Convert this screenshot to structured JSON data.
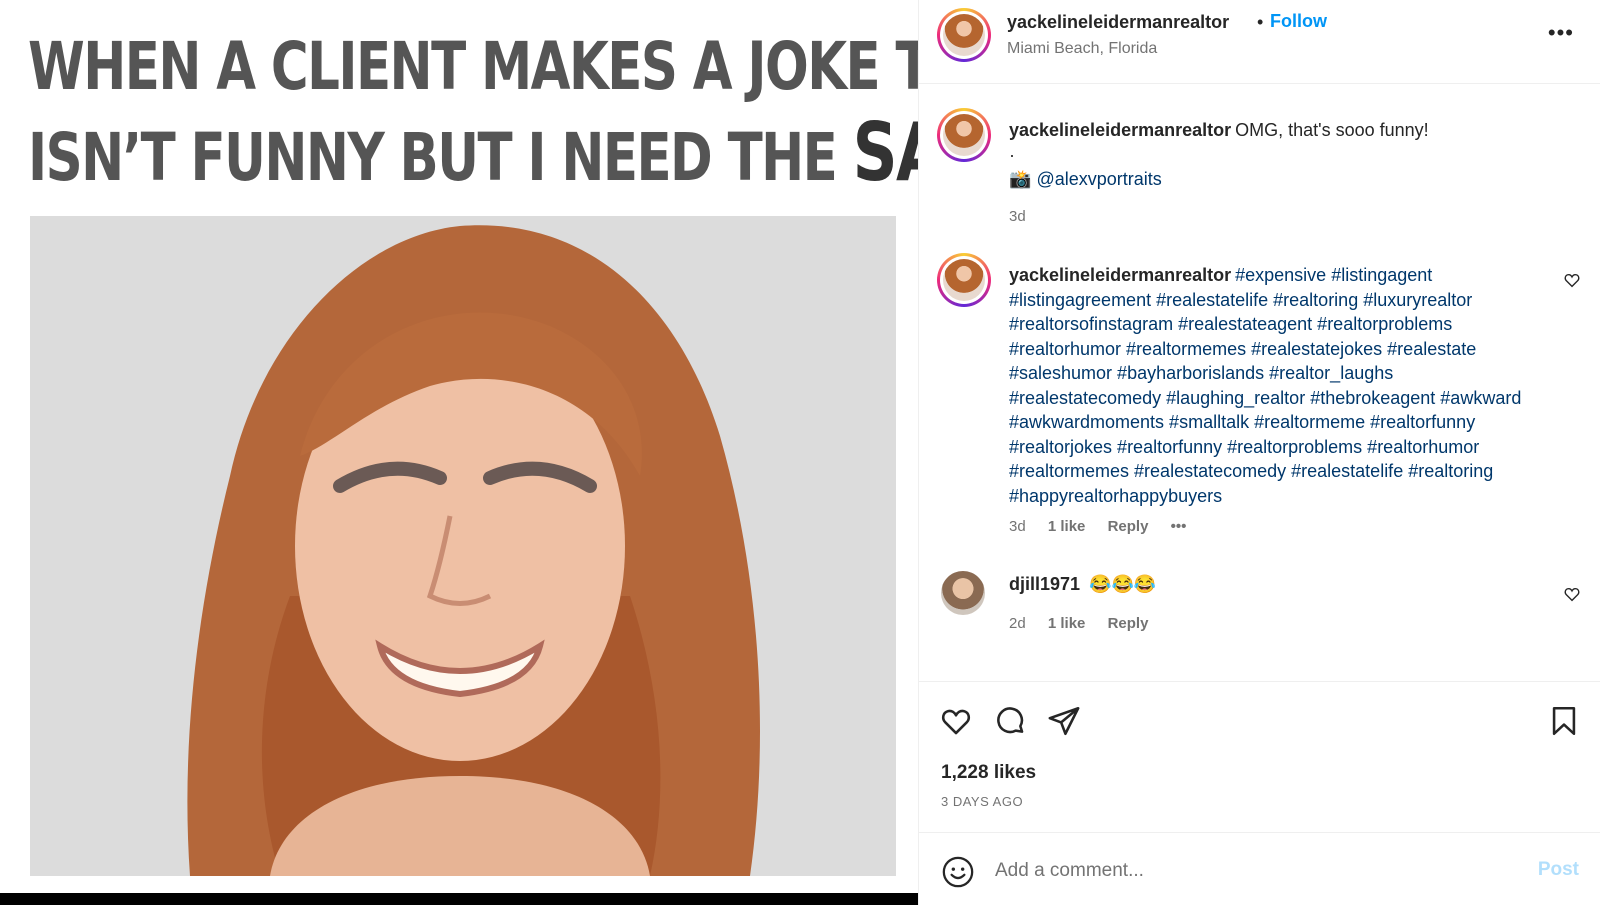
{
  "media": {
    "caption_line1": "WHEN A CLIENT MAKES A JOKE THAT",
    "caption_line2_prefix": "ISN’T FUNNY BUT I NEED THE ",
    "caption_line2_emphasis": "SALE"
  },
  "header": {
    "username": "yackelineleidermanrealtor",
    "separator": "•",
    "follow_label": "Follow",
    "location": "Miami Beach, Florida",
    "more_label": "•••"
  },
  "caption": {
    "username": "yackelineleidermanrealtor",
    "text": "OMG, that's sooo funny!",
    "dot": "·",
    "camera": "📸",
    "mention": "@alexvportraits",
    "time": "3d"
  },
  "hashtag_comment": {
    "username": "yackelineleidermanrealtor",
    "tags": "#expensive #listingagent #listingagreement #realestatelife #realtoring #luxuryrealtor #realtorsofinstagram #realestateagent #realtorproblems #realtorhumor #realtormemes #realestatejokes #realestate #saleshumor #bayharborislands #realtor_laughs #realestatecomedy #laughing_realtor #thebrokeagent #awkward #awkwardmoments #smalltalk #realtormeme #realtorfunny #realtorjokes #realtorfunny #realtorproblems #realtorhumor #realtormemes #realestatecomedy #realestatelife #realtoring #happyrealtorhappybuyers",
    "time": "3d",
    "likes": "1 like",
    "reply": "Reply",
    "more": "•••"
  },
  "reply_comment": {
    "username": "djill1971",
    "text": "😂😂😂",
    "time": "2d",
    "likes": "1 like",
    "reply": "Reply"
  },
  "actions": {
    "likes_count": "1,228 likes",
    "posted_ago": "3 DAYS AGO"
  },
  "add_comment": {
    "placeholder": "Add a comment...",
    "post_label": "Post"
  },
  "colors": {
    "link_blue": "#0095f6",
    "hashtag": "#00376b",
    "muted": "#737373",
    "post_disabled": "#b2dffc"
  }
}
